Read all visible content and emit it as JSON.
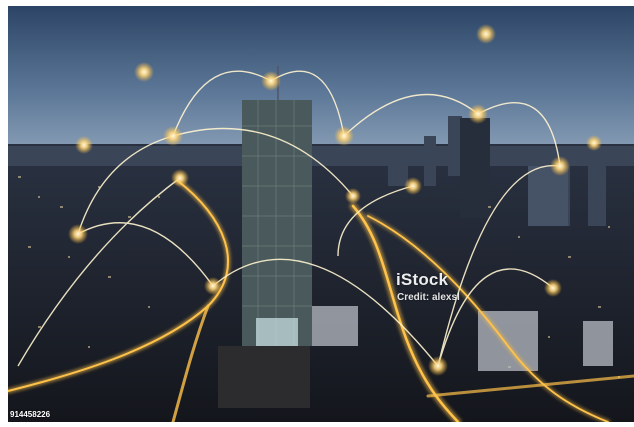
{
  "photo": {
    "description_colors": {
      "sky_top": "#2e4868",
      "sky_bottom": "#8aa0b8",
      "light_trail": "#ffc24a",
      "city_dark": "#1c2230"
    }
  },
  "watermark": {
    "logo": "iStock",
    "credit": "Credit: alexsl"
  },
  "image_id": "914458226"
}
